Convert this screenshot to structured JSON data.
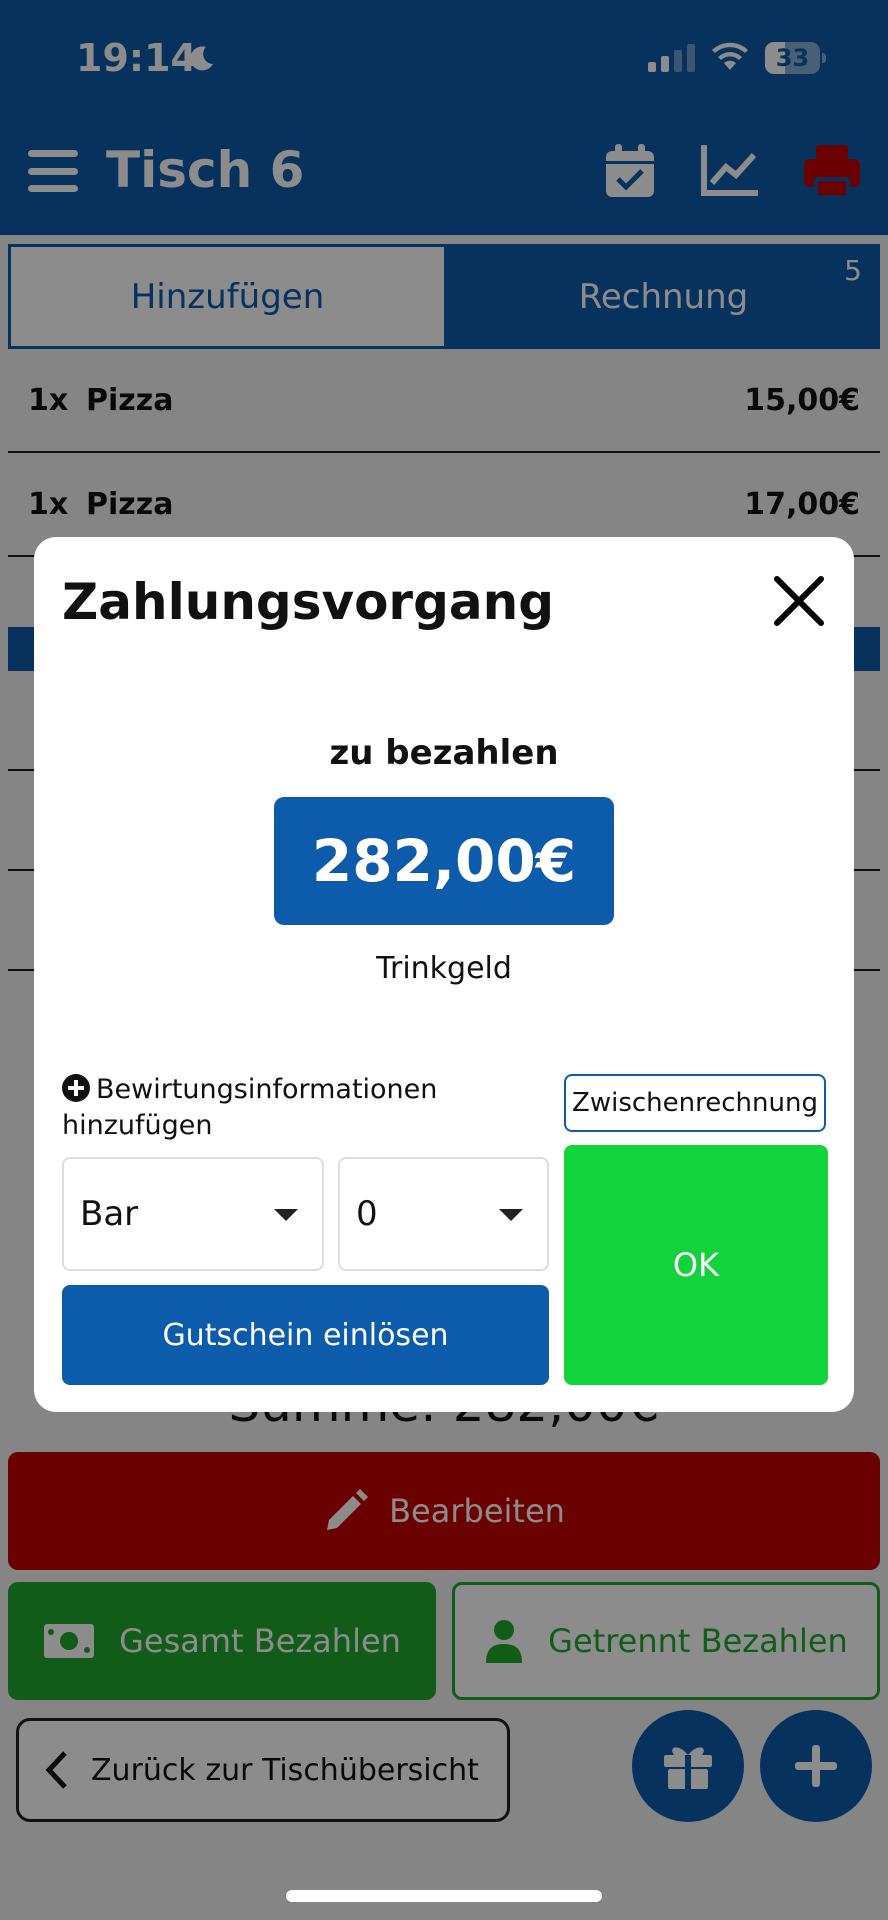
{
  "status_bar": {
    "time": "19:14",
    "battery": "33"
  },
  "header": {
    "title": "Tisch 6"
  },
  "tabs": [
    {
      "label": "Hinzufügen"
    },
    {
      "label": "Rechnung",
      "badge": "5"
    }
  ],
  "bill": {
    "items": [
      {
        "qty": "1x",
        "name": "Pizza",
        "price": "15,00€"
      },
      {
        "qty": "1x",
        "name": "Pizza",
        "price": "17,00€"
      }
    ],
    "sum": "Summe: 282,00€"
  },
  "actions": {
    "edit": "Bearbeiten",
    "pay_all": "Gesamt Bezahlen",
    "pay_split": "Getrennt Bezahlen",
    "back": "Zurück zur Tischübersicht"
  },
  "modal": {
    "title": "Zahlungsvorgang",
    "due_label": "zu bezahlen",
    "due_amount": "282,00€",
    "tip_label": "Trinkgeld",
    "hospitality_info": "Bewirtungsinformationen hinzufügen",
    "interim_bill": "Zwischenrechnung",
    "payment_method": "Bar",
    "tip_amount": "0",
    "voucher": "Gutschein einlösen",
    "ok": "OK"
  },
  "colors": {
    "primary": "#0d5bab",
    "danger": "#c40000",
    "success": "#1fa82d",
    "ok": "#12d33b"
  }
}
